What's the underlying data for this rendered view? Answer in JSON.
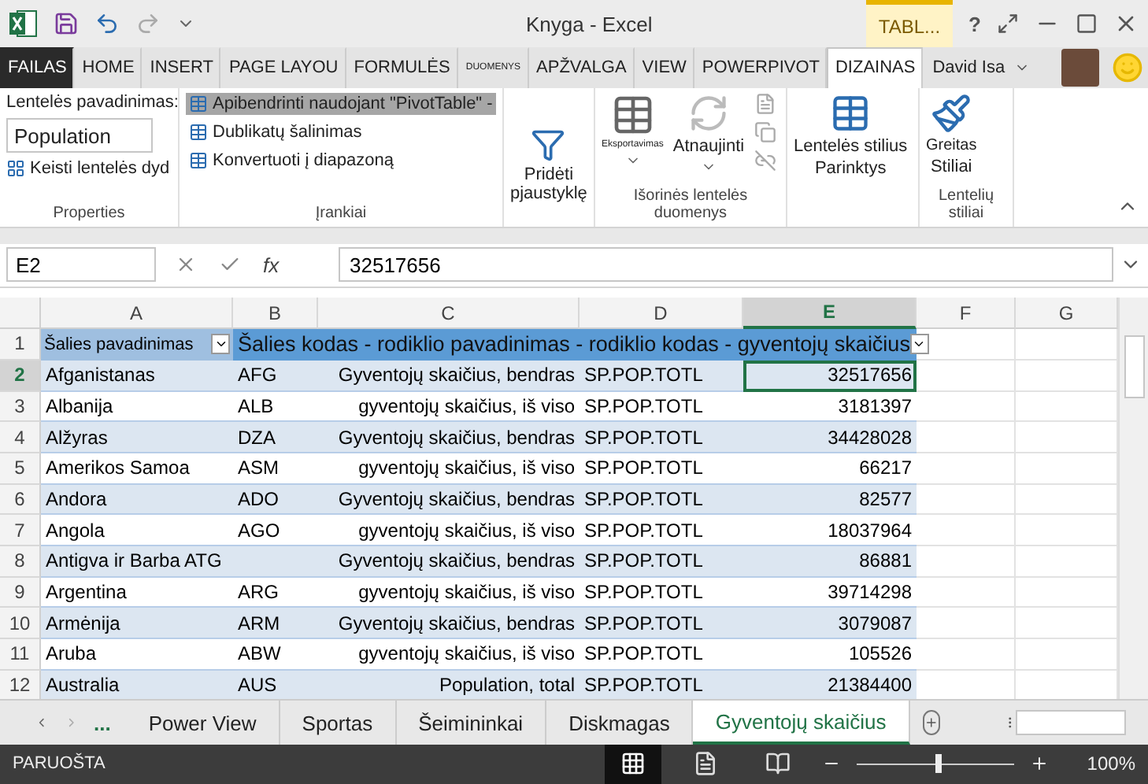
{
  "window": {
    "title": "Knyga - Excel",
    "contextual_tab": "TABL...",
    "help": "?"
  },
  "tabs": [
    {
      "label": "FAILAS",
      "kind": "file",
      "selected": false
    },
    {
      "label": "HOME",
      "kind": "tab",
      "selected": false
    },
    {
      "label": "INSERT",
      "kind": "tab",
      "selected": false
    },
    {
      "label": "PAGE LAYOU",
      "kind": "tab",
      "selected": false
    },
    {
      "label": "FORMULĖS",
      "kind": "tab",
      "selected": false
    },
    {
      "label": "DUOMENYS",
      "kind": "tiny",
      "selected": false
    },
    {
      "label": "APŽVALGA",
      "kind": "tab",
      "selected": false
    },
    {
      "label": "VIEW",
      "kind": "tab",
      "selected": false
    },
    {
      "label": "POWERPIVOT",
      "kind": "tab",
      "selected": false
    },
    {
      "label": "DIZAINAS",
      "kind": "tab",
      "selected": true
    }
  ],
  "user": "David Isa",
  "ribbon": {
    "properties": {
      "name_label": "Lentelės pavadinimas:",
      "name_value": "Population",
      "resize": "Keisti lentelės dyd",
      "group": "Properties"
    },
    "tools": {
      "items": [
        {
          "label": "Apibendrinti naudojant \"PivotTable\" -",
          "selected": true
        },
        {
          "label": "Dublikatų šalinimas",
          "selected": false
        },
        {
          "label": "Konvertuoti į diapazoną",
          "selected": false
        }
      ],
      "slicer": [
        "Pridėti",
        "pjaustyklę"
      ],
      "group": "Įrankiai"
    },
    "external": {
      "export": "Eksportavimas",
      "refresh": "Atnaujinti",
      "group": "Išorinės lentelės duomenys"
    },
    "styles": {
      "options": [
        "Lentelės stilius",
        "Parinktys"
      ],
      "quick": [
        "Greitas",
        "Stiliai"
      ],
      "group": "Lentelių stiliai"
    }
  },
  "formula_bar": {
    "name_box": "E2",
    "fx": "fx",
    "value": "32517656"
  },
  "columns": [
    {
      "label": "A",
      "selected": false
    },
    {
      "label": "B",
      "selected": false
    },
    {
      "label": "C",
      "selected": false
    },
    {
      "label": "D",
      "selected": false
    },
    {
      "label": "E",
      "selected": true
    },
    {
      "label": "F",
      "selected": false
    },
    {
      "label": "G",
      "selected": false
    }
  ],
  "header_row": {
    "number": "1",
    "first": "Šalies pavadinimas",
    "rest": "Šalies kodas - rodiklio pavadinimas - rodiklio kodas - gyventojų skaičius"
  },
  "rows": [
    {
      "number": "2",
      "selected": true,
      "cells": [
        "Afganistanas",
        "AFG",
        "Gyventojų skaičius, bendras",
        "SP.POP.TOTL",
        "32517656"
      ]
    },
    {
      "number": "3",
      "selected": false,
      "cells": [
        "Albanija",
        "ALB",
        "gyventojų skaičius, iš viso",
        "SP.POP.TOTL",
        "3181397"
      ]
    },
    {
      "number": "4",
      "selected": false,
      "cells": [
        "Alžyras",
        "DZA",
        "Gyventojų skaičius, bendras",
        "SP.POP.TOTL",
        "34428028"
      ]
    },
    {
      "number": "5",
      "selected": false,
      "cells": [
        "Amerikos Samoa",
        "ASM",
        "gyventojų skaičius, iš viso",
        "SP.POP.TOTL",
        "66217"
      ]
    },
    {
      "number": "6",
      "selected": false,
      "cells": [
        "Andora",
        "ADO",
        "Gyventojų skaičius, bendras",
        "SP.POP.TOTL",
        "82577"
      ]
    },
    {
      "number": "7",
      "selected": false,
      "cells": [
        "Angola",
        "AGO",
        "gyventojų skaičius, iš viso",
        "SP.POP.TOTL",
        "18037964"
      ]
    },
    {
      "number": "8",
      "selected": false,
      "cells": [
        "Antigva ir Barba ATG",
        null,
        "Gyventojų skaičius, bendras",
        "SP.POP.TOTL",
        "86881"
      ]
    },
    {
      "number": "9",
      "selected": false,
      "cells": [
        "Argentina",
        "ARG",
        "gyventojų skaičius, iš viso",
        "SP.POP.TOTL",
        "39714298"
      ]
    },
    {
      "number": "10",
      "selected": false,
      "cells": [
        "Armėnija",
        "ARM",
        "Gyventojų skaičius, bendras",
        "SP.POP.TOTL",
        "3079087"
      ]
    },
    {
      "number": "11",
      "selected": false,
      "cells": [
        "Aruba",
        "ABW",
        "gyventojų skaičius, iš viso",
        "SP.POP.TOTL",
        "105526"
      ]
    },
    {
      "number": "12",
      "selected": false,
      "cells": [
        "Australia",
        "AUS",
        "Population, total",
        "SP.POP.TOTL",
        "21384400"
      ]
    }
  ],
  "sheet_tabs": {
    "more": "...",
    "tabs": [
      {
        "label": "Power View",
        "selected": false
      },
      {
        "label": "Sportas",
        "selected": false
      },
      {
        "label": "Šeimininkai",
        "selected": false
      },
      {
        "label": "Diskmagas",
        "selected": false
      },
      {
        "label": "Gyventojų skaičius",
        "selected": true
      }
    ]
  },
  "status_bar": {
    "text": "PARUOŠTA",
    "zoom": "100%",
    "level": 0.5
  }
}
